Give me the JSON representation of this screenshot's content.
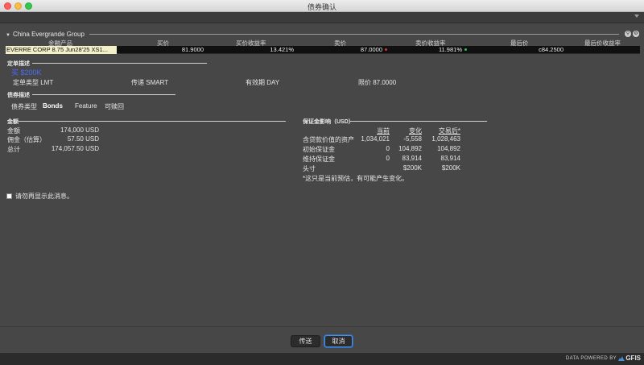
{
  "window": {
    "title": "债券确认"
  },
  "group": {
    "title": "China Evergrande Group"
  },
  "table": {
    "headers": [
      "金融产品",
      "买价",
      "买价收益率",
      "卖价",
      "卖价收益率",
      "最后价",
      "最后价收益率"
    ],
    "row": {
      "product": "EVERRE CORP 8.75 Jun28'25 XS1...",
      "bid": "81.9000",
      "bid_yield": "13.421%",
      "ask": "87.0000",
      "ask_yield": "11.981%",
      "last": "c84.2500",
      "ask_dot_color": "#e03030",
      "ask_yield_dot_color": "#30c060"
    }
  },
  "order": {
    "section_label": "定单描述",
    "action": "买 $200K",
    "type_label": "定单类型",
    "type_value": "LMT",
    "route_label": "传递",
    "route_value": "SMART",
    "tif_label": "有效期",
    "tif_value": "DAY",
    "limit_label": "限价",
    "limit_value": "87.0000"
  },
  "bond": {
    "section_label": "债券描述",
    "tabs": [
      "债券类型",
      "Bonds",
      "Feature",
      "可赎回"
    ]
  },
  "amount": {
    "section_label": "金额",
    "rows": [
      {
        "label": "金额",
        "value": "174,000 USD"
      },
      {
        "label": "佣金（估算）",
        "value": "57.50 USD"
      },
      {
        "label": "总计",
        "value": "174,057.50 USD"
      }
    ]
  },
  "margin": {
    "section_label": "保证金影响（USD）",
    "headers": [
      "当前",
      "变化",
      "交易后*"
    ],
    "rows": [
      {
        "label": "含贷款价值的资产",
        "values": [
          "1,034,021",
          "-5,558",
          "1,028,463"
        ]
      },
      {
        "label": "初始保证金",
        "values": [
          "0",
          "104,892",
          "104,892"
        ]
      },
      {
        "label": "维持保证金",
        "values": [
          "0",
          "83,914",
          "83,914"
        ]
      },
      {
        "label": "头寸",
        "values": [
          "",
          "$200K",
          "$200K"
        ]
      }
    ],
    "note": "*这只是当前预估，有可能产生变化。"
  },
  "dont_show": {
    "label": "请勿再显示此消息。"
  },
  "buttons": {
    "transmit": "传送",
    "cancel": "取消"
  },
  "footer": {
    "powered": "DATA POWERED BY",
    "brand": "GFIS"
  },
  "icons": {
    "collapse": "triangle-down-icon",
    "search": "search-icon",
    "settings": "gear-icon"
  }
}
